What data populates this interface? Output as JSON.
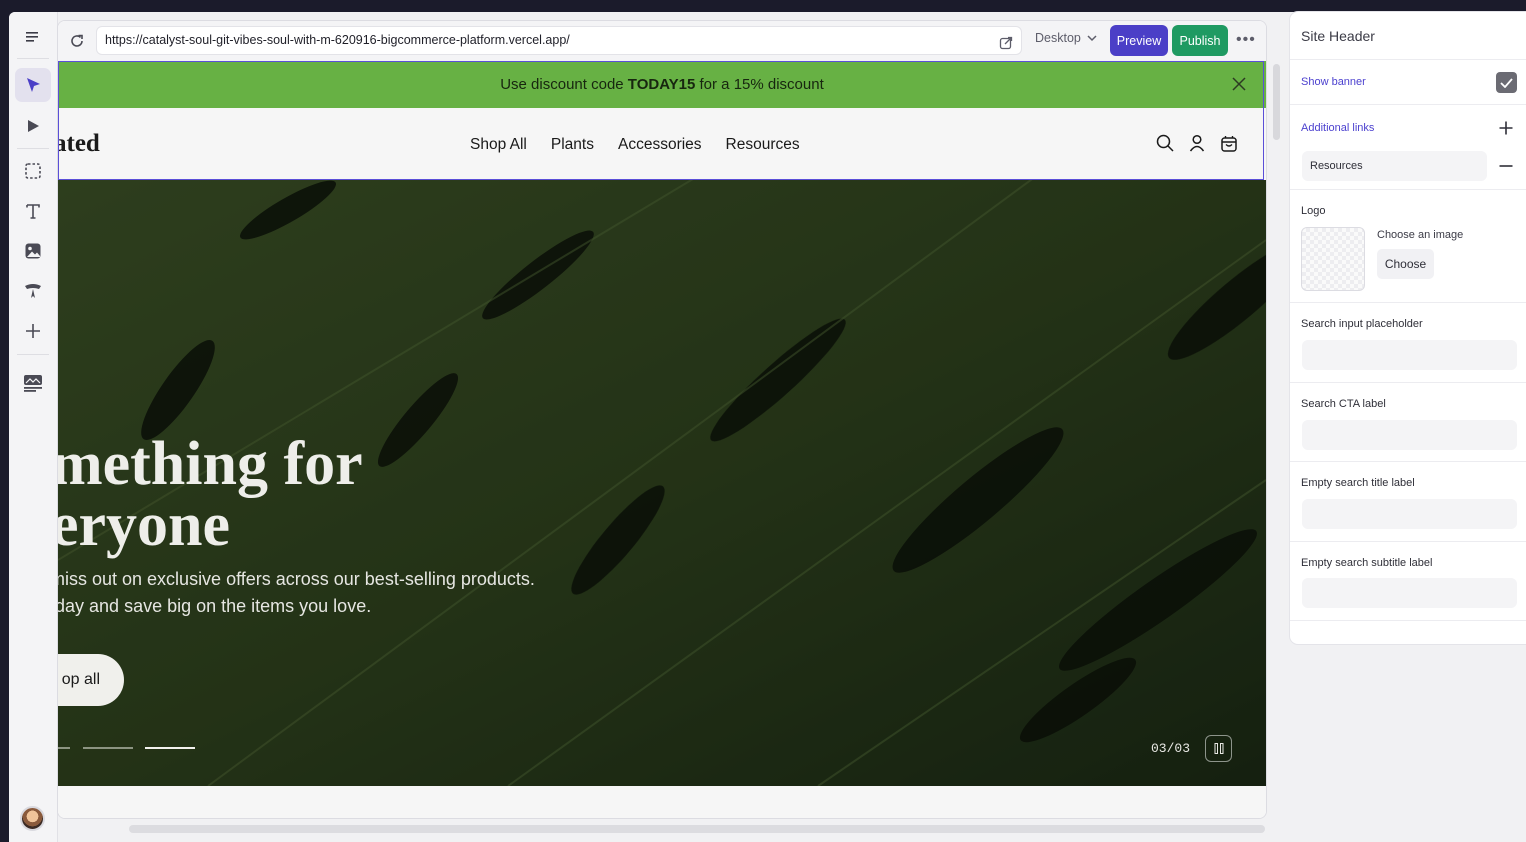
{
  "browser": {
    "url": "https://catalyst-soul-git-vibes-soul-with-m-620916-bigcommerce-platform.vercel.app/",
    "device": "Desktop",
    "preview_label": "Preview",
    "publish_label": "Publish",
    "more_label": "•••"
  },
  "site": {
    "banner": {
      "prefix": "Use discount code ",
      "code": "TODAY15",
      "suffix": " for a 15% discount"
    },
    "logo_text": "ated",
    "nav": [
      "Shop All",
      "Plants",
      "Accessories",
      "Resources"
    ],
    "hero": {
      "title_line1": "omething for",
      "title_line2": "veryone",
      "subtitle_line1": "t miss out on exclusive offers across our best-selling products.",
      "subtitle_line2": "today and save big on the items you love.",
      "cta": "op all",
      "counter": "03/03"
    }
  },
  "panel": {
    "title": "Site Header",
    "show_banner": "Show banner",
    "show_banner_checked": true,
    "additional_links": "Additional links",
    "link_value": "Resources",
    "logo_label": "Logo",
    "choose_image": "Choose an image",
    "choose_button": "Choose",
    "search_placeholder_label": "Search input placeholder",
    "search_cta_label": "Search CTA label",
    "empty_title_label": "Empty search title label",
    "empty_subtitle_label": "Empty search subtitle label"
  },
  "colors": {
    "accent": "#4b3fc7",
    "publish": "#1f9a62",
    "banner": "#67b144"
  }
}
